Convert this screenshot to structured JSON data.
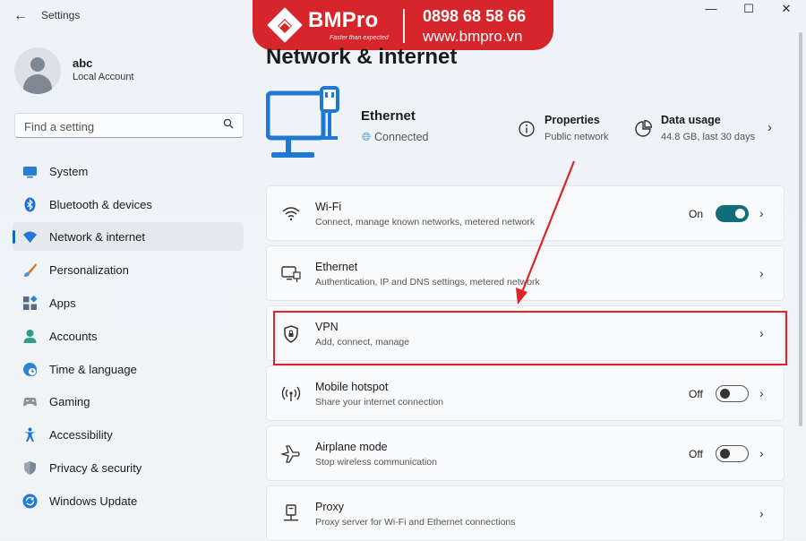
{
  "window": {
    "title": "Settings",
    "controls": [
      "—",
      "☐",
      "✕"
    ]
  },
  "brand": {
    "name": "BMPro",
    "tagline": "Faster than expected",
    "phone": "0898 68 58 66",
    "website": "www.bmpro.vn"
  },
  "user": {
    "name": "abc",
    "account_type": "Local Account"
  },
  "search": {
    "placeholder": "Find a setting",
    "icon": "search-icon"
  },
  "sidebar": {
    "items": [
      {
        "label": "System",
        "icon": "monitor-icon",
        "color": "#2b7cd3"
      },
      {
        "label": "Bluetooth & devices",
        "icon": "bluetooth-icon",
        "color": "#1d6fd6"
      },
      {
        "label": "Network & internet",
        "icon": "wifi-icon",
        "color": "#1f78d1",
        "active": true
      },
      {
        "label": "Personalization",
        "icon": "brush-icon",
        "color": "#d08a3a"
      },
      {
        "label": "Apps",
        "icon": "apps-icon",
        "color": "#5a6b86"
      },
      {
        "label": "Accounts",
        "icon": "person-icon",
        "color": "#2e9e8a"
      },
      {
        "label": "Time & language",
        "icon": "globe-clock-icon",
        "color": "#2b86d4"
      },
      {
        "label": "Gaming",
        "icon": "gamepad-icon",
        "color": "#8a94a0"
      },
      {
        "label": "Accessibility",
        "icon": "accessibility-icon",
        "color": "#1a73c8"
      },
      {
        "label": "Privacy & security",
        "icon": "shield-icon",
        "color": "#7c8794"
      },
      {
        "label": "Windows Update",
        "icon": "refresh-icon",
        "color": "#1f78d1"
      }
    ]
  },
  "main": {
    "title": "Network & internet",
    "connection": {
      "name": "Ethernet",
      "status": "Connected"
    },
    "properties": {
      "title": "Properties",
      "subtitle": "Public network"
    },
    "data_usage": {
      "title": "Data usage",
      "subtitle": "44.8 GB, last 30 days"
    },
    "cards": [
      {
        "title": "Wi-Fi",
        "subtitle": "Connect, manage known networks, metered network",
        "icon": "wifi-icon",
        "state": "On",
        "toggle": "on"
      },
      {
        "title": "Ethernet",
        "subtitle": "Authentication, IP and DNS settings, metered network",
        "icon": "ethernet-icon"
      },
      {
        "title": "VPN",
        "subtitle": "Add, connect, manage",
        "icon": "vpn-shield-icon"
      },
      {
        "title": "Mobile hotspot",
        "subtitle": "Share your internet connection",
        "icon": "hotspot-icon",
        "state": "Off",
        "toggle": "off"
      },
      {
        "title": "Airplane mode",
        "subtitle": "Stop wireless communication",
        "icon": "airplane-icon",
        "state": "Off",
        "toggle": "off"
      },
      {
        "title": "Proxy",
        "subtitle": "Proxy server for Wi-Fi and Ethernet connections",
        "icon": "proxy-icon"
      }
    ]
  },
  "annotation": {
    "color": "#e0232a",
    "target": "VPN"
  },
  "colors": {
    "accent": "#0f6cbd",
    "toggle_on": "#0f6e7a",
    "brand": "#d7262b"
  }
}
